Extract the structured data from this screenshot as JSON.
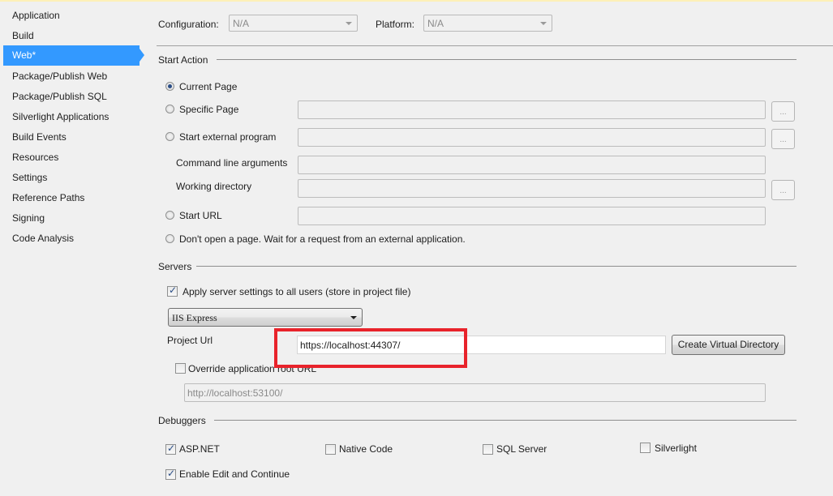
{
  "sidebar": {
    "items": [
      {
        "label": "Application"
      },
      {
        "label": "Build"
      },
      {
        "label": "Web*",
        "active": true
      },
      {
        "label": "Package/Publish Web"
      },
      {
        "label": "Package/Publish SQL"
      },
      {
        "label": "Silverlight Applications"
      },
      {
        "label": "Build Events"
      },
      {
        "label": "Resources"
      },
      {
        "label": "Settings"
      },
      {
        "label": "Reference Paths"
      },
      {
        "label": "Signing"
      },
      {
        "label": "Code Analysis"
      }
    ]
  },
  "config": {
    "configuration_label": "Configuration:",
    "configuration_value": "N/A",
    "platform_label": "Platform:",
    "platform_value": "N/A"
  },
  "start_action": {
    "heading": "Start Action",
    "current_page": "Current Page",
    "specific_page": "Specific Page",
    "specific_page_value": "",
    "start_external_program": "Start external program",
    "external_program_value": "",
    "command_line_arguments": "Command line arguments",
    "command_line_value": "",
    "working_directory": "Working directory",
    "working_directory_value": "",
    "start_url": "Start URL",
    "start_url_value": "",
    "dont_open": "Don't open a page.  Wait for a request from an external application.",
    "browse_label": "...",
    "selected": "Current Page"
  },
  "servers": {
    "heading": "Servers",
    "apply_all_users": "Apply server settings to all users (store in project file)",
    "apply_all_users_checked": true,
    "server_type": "IIS Express",
    "project_url_label": "Project Url",
    "project_url_value": "https://localhost:44307/",
    "create_virtual_directory": "Create Virtual Directory",
    "override_root_url": "Override application root URL",
    "override_root_url_checked": false,
    "override_root_url_value": "http://localhost:53100/"
  },
  "debuggers": {
    "heading": "Debuggers",
    "aspnet": "ASP.NET",
    "aspnet_checked": true,
    "native_code": "Native Code",
    "native_code_checked": false,
    "sql_server": "SQL Server",
    "sql_server_checked": false,
    "silverlight": "Silverlight",
    "silverlight_checked": false,
    "edit_continue": "Enable Edit and Continue",
    "edit_continue_checked": true
  },
  "annotation": {
    "highlight_color": "#e8232b"
  },
  "colors": {
    "accent": "#3399ff",
    "background": "#f0f0f0"
  }
}
